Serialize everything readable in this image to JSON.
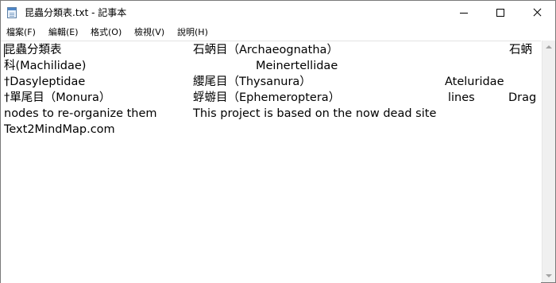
{
  "window": {
    "title": "昆蟲分類表.txt - 記事本",
    "app_icon": "notepad-icon",
    "controls": {
      "minimize_icon": "minimize-icon",
      "maximize_icon": "maximize-icon",
      "close_icon": "close-icon"
    }
  },
  "menubar": {
    "items": [
      {
        "label": "檔案(F)"
      },
      {
        "label": "編輯(E)"
      },
      {
        "label": "格式(O)"
      },
      {
        "label": "檢視(V)"
      },
      {
        "label": "說明(H)"
      }
    ]
  },
  "document": {
    "lines": [
      [
        "昆蟲分類表",
        "石蛃目（Archaeognatha）",
        "石蛃"
      ],
      [
        "科(Machilidae)",
        "Meinertellidae"
      ],
      [
        "†Dasyleptidae",
        "纓尾目（Thysanura）",
        "Ateluridae"
      ],
      [
        "†單尾目（Monura）",
        "蜉蝣目（Ephemeroptera）",
        "lines",
        "Drag"
      ],
      [
        "nodes to re-organize them",
        "This project is based on the now dead site"
      ],
      [
        "Text2MindMap.com"
      ]
    ]
  },
  "scrollbar": {
    "up_icon": "scroll-up-arrow-icon",
    "down_icon": "scroll-down-arrow-icon"
  }
}
